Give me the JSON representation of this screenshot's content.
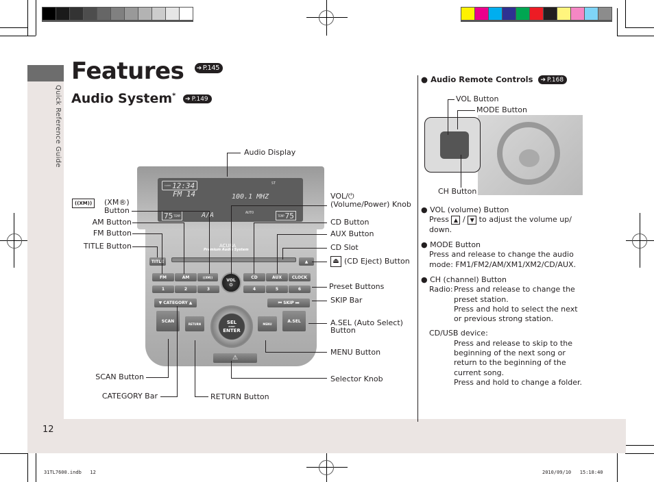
{
  "color_bars": {
    "grayscale": [
      "#000000",
      "#1a1a1a",
      "#333333",
      "#4d4d4d",
      "#666666",
      "#808080",
      "#999999",
      "#b3b3b3",
      "#cccccc",
      "#e6e6e6",
      "#ffffff"
    ],
    "process": [
      "#fff100",
      "#ec008c",
      "#00aeef",
      "#2e3192",
      "#00a651",
      "#ed1c24",
      "#231f20",
      "#fff57d",
      "#f587c4",
      "#7fd4f7",
      "#8c8c8c"
    ]
  },
  "sidebar": {
    "label": "Quick Reference Guide"
  },
  "header": {
    "title": "Features",
    "title_ref": "P.145",
    "subtitle": "Audio System",
    "subtitle_mark": "*",
    "subtitle_ref": "P.149"
  },
  "head_unit": {
    "display": {
      "clock_tag": "CLOCK",
      "clock": "12:34",
      "band": "FM 14",
      "freq": "100.1 MHZ",
      "st": "ST",
      "temp_left": "75",
      "temp_right": "75",
      "temp_tag": "TEMP",
      "fan": "AUTO",
      "mode": "A/A"
    },
    "brand": "ACURA",
    "brand_sub": "Premium Audio System",
    "buttons": {
      "title": "TITLE",
      "fm": "FM",
      "am": "AM",
      "xm": "((XM))",
      "vol": "VOL",
      "cd": "CD",
      "aux": "AUX",
      "clock": "CLOCK",
      "eject": "▲",
      "presets": [
        "1",
        "2",
        "3",
        "4",
        "5",
        "6"
      ],
      "category": "▼ CATEGORY ▲",
      "skip": "⏮ SKIP ⏭",
      "scan": "SCAN",
      "return": "RETURN",
      "sel": "SEL",
      "push": "PUSH",
      "enter": "ENTER",
      "menu": "MENU",
      "asel": "A.SEL",
      "hazard": "⚠"
    }
  },
  "callouts": {
    "audio_display": "Audio Display",
    "xm_badge": "((XM))",
    "xm_label_1": "(XM®)",
    "xm_label_2": "Button",
    "am_button": "AM Button",
    "fm_button": "FM Button",
    "title_button": "TITLE Button",
    "vol_1": "VOL/⏻",
    "vol_2": "(Volume/Power) Knob",
    "cd_button": "CD Button",
    "aux_button": "AUX Button",
    "cd_slot": "CD Slot",
    "cd_eject": "(CD Eject) Button",
    "preset_buttons": "Preset Buttons",
    "skip_bar": "SKIP Bar",
    "asel_1": "A.SEL (Auto Select)",
    "asel_2": "Button",
    "menu_button": "MENU Button",
    "selector_knob": "Selector Knob",
    "scan_button": "SCAN Button",
    "category_bar": "CATEGORY Bar",
    "return_button": "RETURN Button"
  },
  "remote": {
    "heading": "Audio Remote Controls",
    "heading_ref": "P.168",
    "vol_button": "VOL Button",
    "mode_button": "MODE Button",
    "ch_button": "CH Button",
    "sections": [
      {
        "title": "VOL (volume) Button",
        "lines": [
          "Press ▲ / ▼ to adjust the volume up/",
          "down."
        ]
      },
      {
        "title": "MODE Button",
        "lines": [
          "Press and release to change the audio",
          "mode: FM1/FM2/AM/XM1/XM2/CD/AUX."
        ]
      },
      {
        "title": "CH (channel) Button"
      }
    ],
    "vol_press": "Press",
    "vol_up": "▲",
    "vol_slash": "/",
    "vol_down": "▼",
    "vol_rest": "to adjust the volume up/",
    "vol_rest2": "down.",
    "ch_radio_label": "Radio:",
    "ch_radio_lines": [
      "Press and release to change the",
      "preset station.",
      "Press and hold to select the next",
      "or previous strong station."
    ],
    "ch_cd_label": "CD/USB device:",
    "ch_cd_lines": [
      "Press and release to skip to the",
      "beginning of the next song or",
      "return to the beginning of the",
      "current song.",
      "Press and hold to change a folder."
    ]
  },
  "footer": {
    "page_number": "12",
    "file": "31TL7600.indb   12",
    "timestamp": "2010/09/10   15:18:40"
  }
}
